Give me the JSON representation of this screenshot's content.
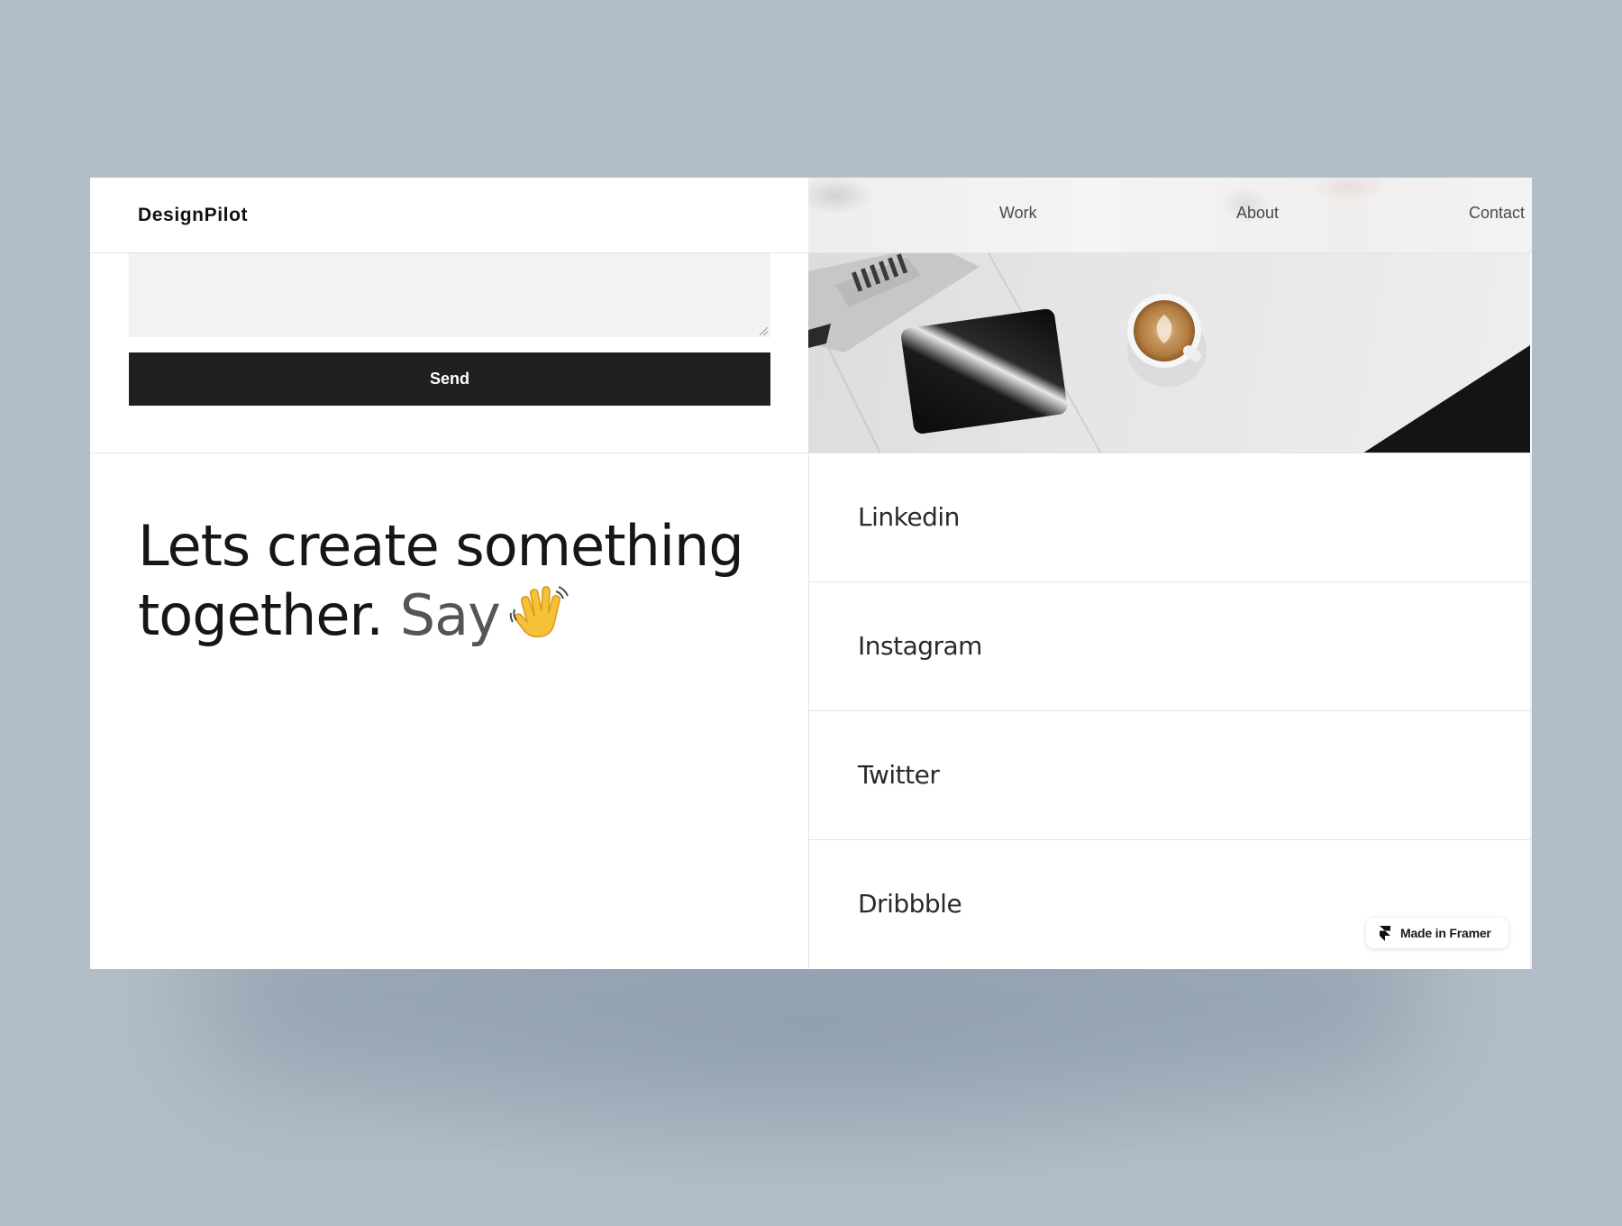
{
  "header": {
    "brand": "DesignPilot",
    "nav": {
      "work": "Work",
      "about": "About",
      "contact": "Contact"
    }
  },
  "contact_form": {
    "message_value": "",
    "send_label": "Send"
  },
  "photo": {
    "subject": "desk with tablet and coffee cup"
  },
  "headline": {
    "line1": "Lets create something",
    "line2_main": "together.",
    "line2_accent": "Say",
    "emoji": "👋"
  },
  "social": {
    "items": [
      {
        "label": "Linkedin"
      },
      {
        "label": "Instagram"
      },
      {
        "label": "Twitter"
      },
      {
        "label": "Dribbble"
      }
    ]
  },
  "badge": {
    "label": "Made in Framer",
    "icon": "framer-logo-icon"
  },
  "colors": {
    "page_background": "#b1bdc7",
    "button_background": "#202020",
    "text_primary": "#161616",
    "text_accent": "#555555"
  }
}
